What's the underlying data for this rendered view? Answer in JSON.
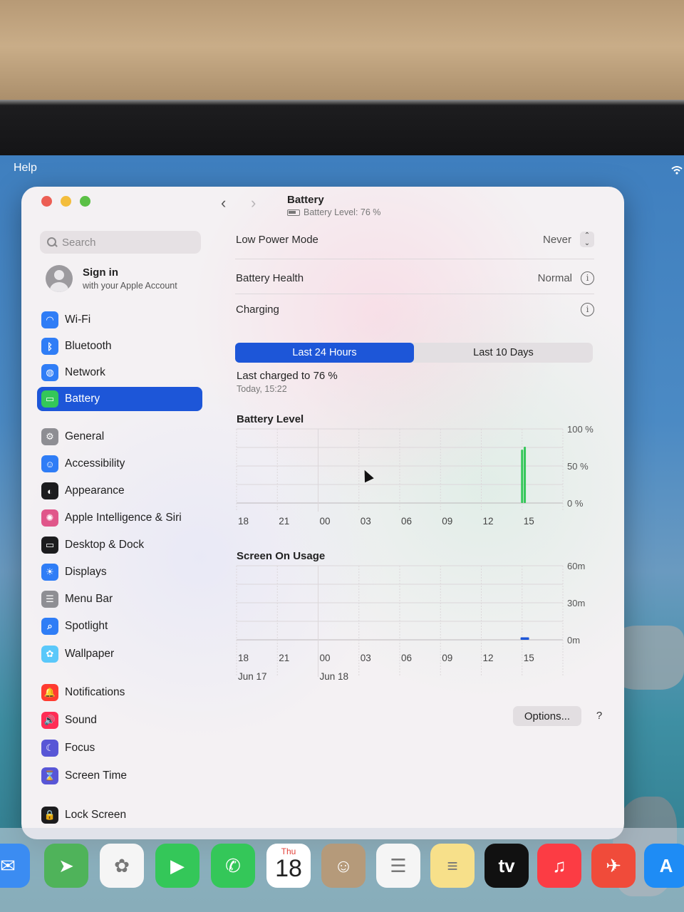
{
  "menubar": {
    "help_label": "Help"
  },
  "window": {
    "title": "Battery",
    "subtitle": "Battery Level: 76 %"
  },
  "sidebar": {
    "search_placeholder": "Search",
    "account": {
      "name": "Sign in",
      "sub": "with your Apple Account"
    },
    "items": [
      {
        "label": "Wi-Fi",
        "icon": "wifi-icon",
        "color": "#2f7df6"
      },
      {
        "label": "Bluetooth",
        "icon": "bluetooth-icon",
        "color": "#2f7df6"
      },
      {
        "label": "Network",
        "icon": "globe-icon",
        "color": "#2f7df6"
      },
      {
        "label": "Battery",
        "icon": "battery-icon",
        "color": "#34c759",
        "selected": true
      },
      {
        "label": "General",
        "icon": "gear-icon",
        "color": "#8e8e93"
      },
      {
        "label": "Accessibility",
        "icon": "accessibility-icon",
        "color": "#2f7df6"
      },
      {
        "label": "Appearance",
        "icon": "appearance-icon",
        "color": "#1c1c1e"
      },
      {
        "label": "Apple Intelligence & Siri",
        "icon": "siri-icon",
        "color": "#e0568a"
      },
      {
        "label": "Desktop & Dock",
        "icon": "dock-icon",
        "color": "#1c1c1e"
      },
      {
        "label": "Displays",
        "icon": "sun-icon",
        "color": "#2f7df6"
      },
      {
        "label": "Menu Bar",
        "icon": "menubar-icon",
        "color": "#8e8e93"
      },
      {
        "label": "Spotlight",
        "icon": "magnifier-icon",
        "color": "#2f7df6"
      },
      {
        "label": "Wallpaper",
        "icon": "flower-icon",
        "color": "#5ac8fa"
      },
      {
        "label": "Notifications",
        "icon": "bell-icon",
        "color": "#ff3b30"
      },
      {
        "label": "Sound",
        "icon": "speaker-icon",
        "color": "#ff2d55"
      },
      {
        "label": "Focus",
        "icon": "moon-icon",
        "color": "#5856d6"
      },
      {
        "label": "Screen Time",
        "icon": "hourglass-icon",
        "color": "#5856d6"
      },
      {
        "label": "Lock Screen",
        "icon": "lock-icon",
        "color": "#1c1c1e"
      }
    ]
  },
  "settings": {
    "low_power": {
      "label": "Low Power Mode",
      "value": "Never"
    },
    "health": {
      "label": "Battery Health",
      "value": "Normal"
    },
    "charging": {
      "label": "Charging"
    }
  },
  "segments": {
    "left": "Last 24 Hours",
    "right": "Last 10 Days",
    "active": "left"
  },
  "last_charged": {
    "text": "Last charged to 76 %",
    "time": "Today, 15:22"
  },
  "chart_data": [
    {
      "type": "bar",
      "title": "Battery Level",
      "x_ticks": [
        "18",
        "21",
        "00",
        "03",
        "06",
        "09",
        "12",
        "15"
      ],
      "y_ticks": [
        "100 %",
        "50 %",
        "0 %"
      ],
      "ylim": [
        0,
        100
      ],
      "bars": [
        {
          "hour_offset": 21.0,
          "value": 72,
          "color": "#34c759"
        },
        {
          "hour_offset": 21.2,
          "value": 76,
          "color": "#34c759"
        }
      ],
      "accent": "#34c759"
    },
    {
      "type": "bar",
      "title": "Screen On Usage",
      "x_ticks": [
        "18",
        "21",
        "00",
        "03",
        "06",
        "09",
        "12",
        "15"
      ],
      "y_ticks": [
        "60m",
        "30m",
        "0m"
      ],
      "ylim": [
        0,
        60
      ],
      "date_labels": [
        {
          "text": "Jun 17",
          "at_tick": 0
        },
        {
          "text": "Jun 18",
          "at_tick": 2
        }
      ],
      "bars": [
        {
          "hour_offset": 21.2,
          "value": 2,
          "color": "#1d56d8"
        }
      ],
      "accent": "#1d56d8"
    }
  ],
  "footer": {
    "options_label": "Options...",
    "help_label": "?"
  },
  "dock": {
    "calendar": {
      "day": "Thu",
      "date": "18"
    },
    "items": [
      {
        "name": "mail-icon",
        "color": "#3b8cf2",
        "glyph": "✉"
      },
      {
        "name": "maps-icon",
        "color": "#4fb35a",
        "glyph": "➤"
      },
      {
        "name": "photos-icon",
        "color": "#f5f5f5",
        "glyph": "✿"
      },
      {
        "name": "facetime-icon",
        "color": "#34c759",
        "glyph": "▶"
      },
      {
        "name": "phone-icon",
        "color": "#34c759",
        "glyph": "✆"
      },
      {
        "name": "calendar-icon",
        "color": "#ffffff",
        "glyph": ""
      },
      {
        "name": "contacts-icon",
        "color": "#b59a7a",
        "glyph": "☺"
      },
      {
        "name": "reminders-icon",
        "color": "#f5f5f5",
        "glyph": "☰"
      },
      {
        "name": "notes-icon",
        "color": "#f7e08a",
        "glyph": "≡"
      },
      {
        "name": "tv-icon",
        "color": "#111111",
        "glyph": "tv"
      },
      {
        "name": "music-icon",
        "color": "#fc3c44",
        "glyph": "♫"
      },
      {
        "name": "launchpad-icon",
        "color": "#f04b3a",
        "glyph": "✈"
      },
      {
        "name": "appstore-icon",
        "color": "#1e8cf5",
        "glyph": "A"
      }
    ]
  }
}
